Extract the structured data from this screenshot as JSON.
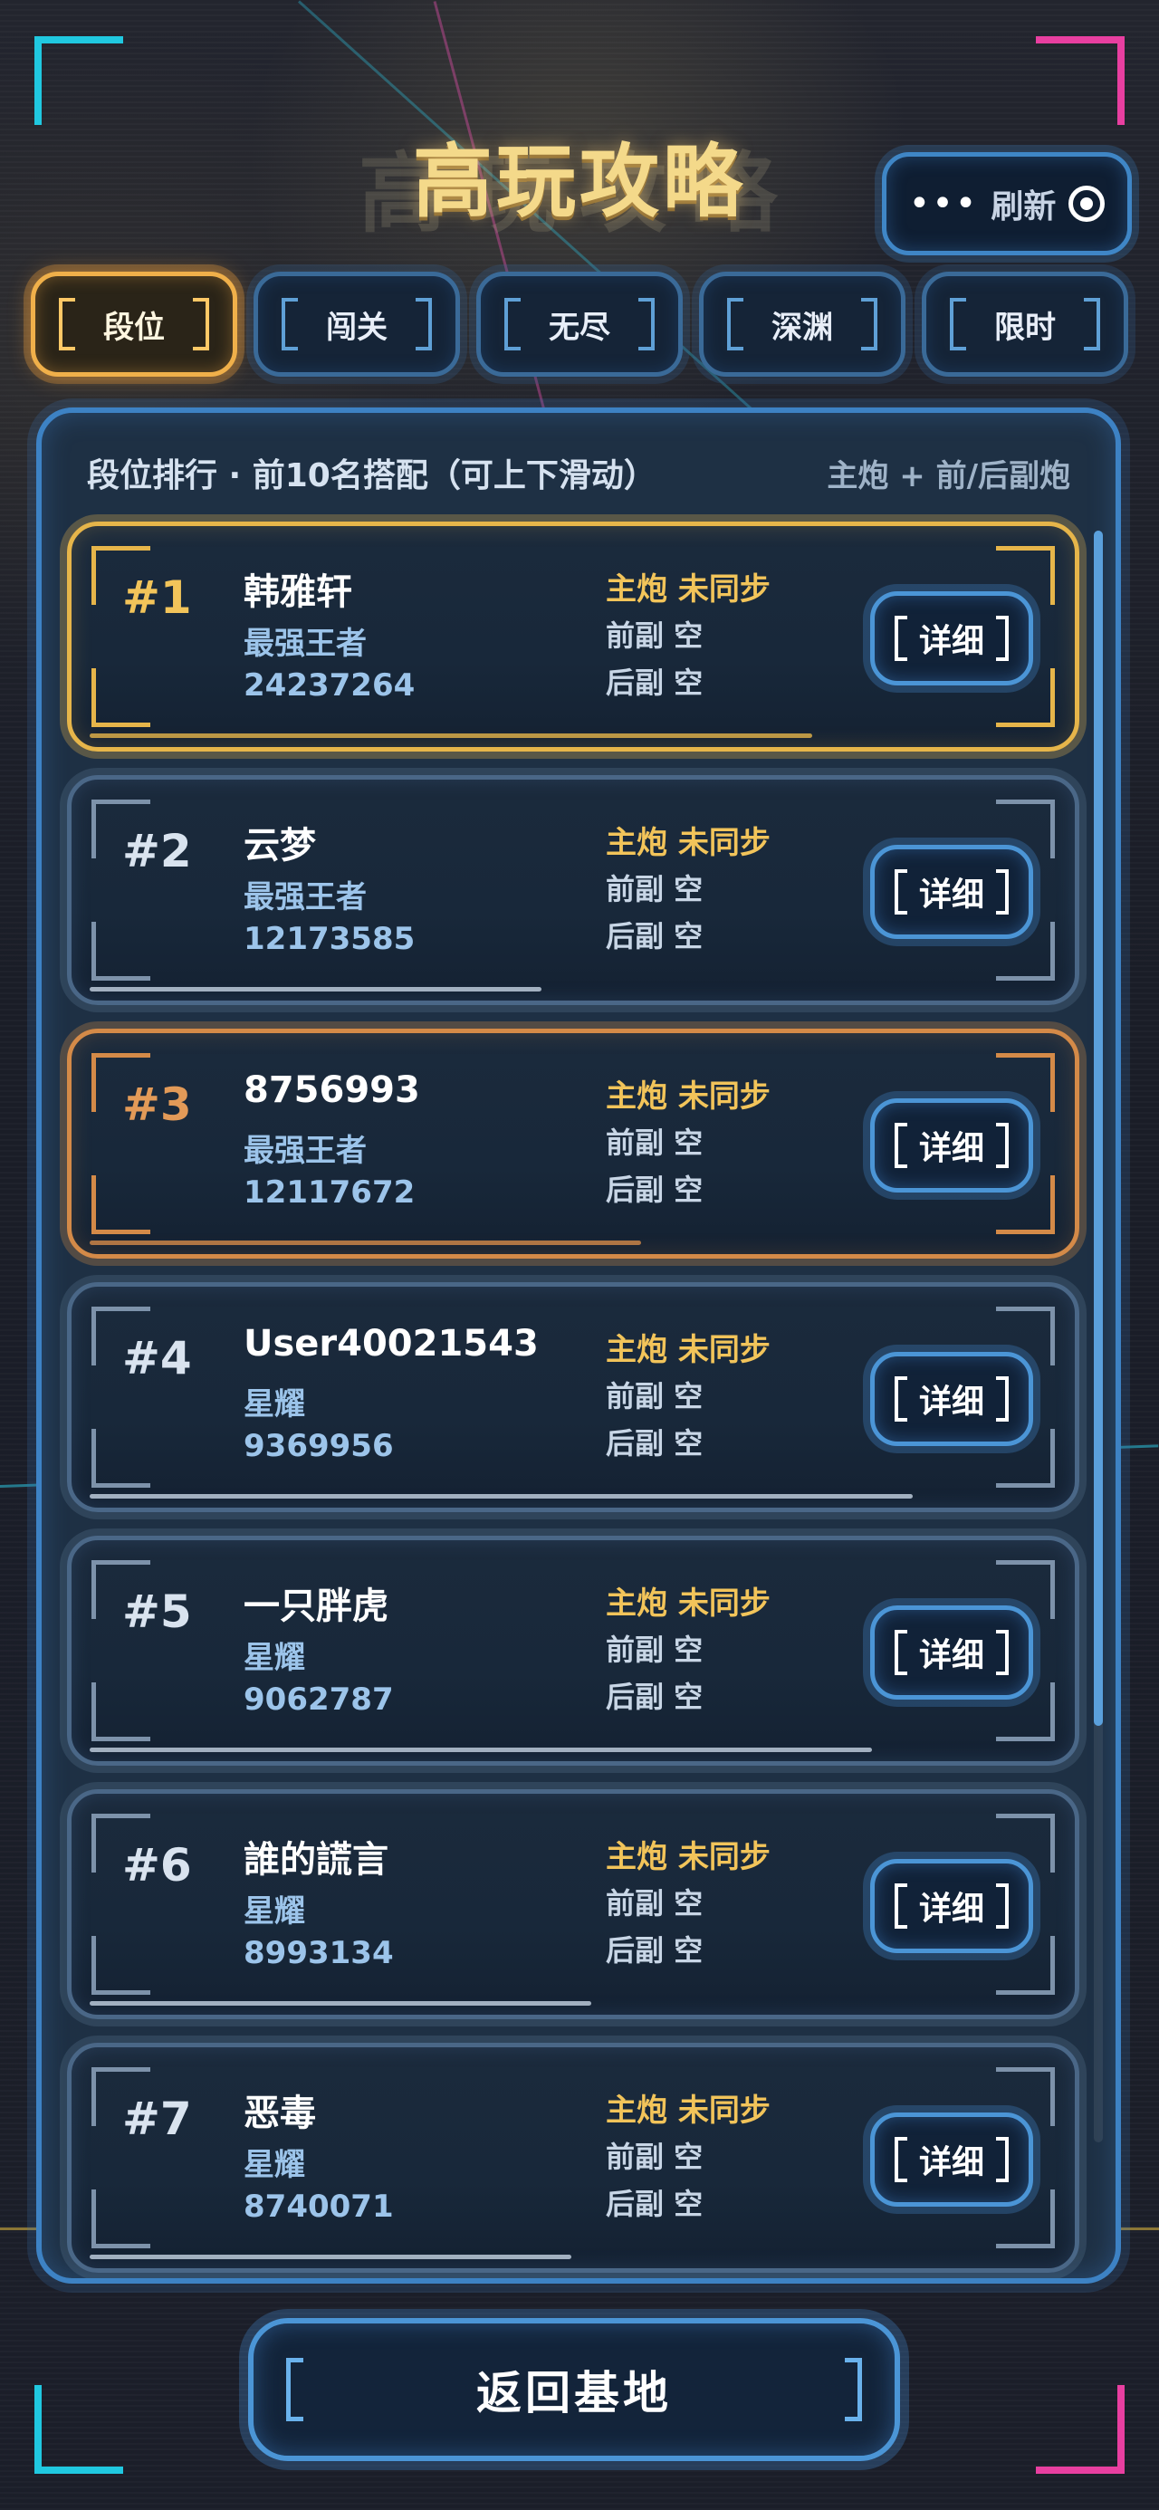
{
  "header": {
    "title": "高玩攻略",
    "refresh_dots": "•••",
    "refresh_label": "刷新"
  },
  "tabs": [
    {
      "label": "段位",
      "active": true
    },
    {
      "label": "闯关",
      "active": false
    },
    {
      "label": "无尽",
      "active": false
    },
    {
      "label": "深渊",
      "active": false
    },
    {
      "label": "限时",
      "active": false
    }
  ],
  "panel": {
    "heading": "段位排行 · 前10名搭配（可上下滑动）",
    "legend": "主炮 + 前/后副炮"
  },
  "entries": [
    {
      "rank": "#1",
      "name": "韩雅轩",
      "tier": "最强王者",
      "score": "24237264",
      "main": "主炮  未同步",
      "front": "前副  空",
      "rear": "后副  空",
      "detail": "详细",
      "progress": 0.72
    },
    {
      "rank": "#2",
      "name": "云梦",
      "tier": "最强王者",
      "score": "12173585",
      "main": "主炮  未同步",
      "front": "前副  空",
      "rear": "后副  空",
      "detail": "详细",
      "progress": 0.45
    },
    {
      "rank": "#3",
      "name": "8756993",
      "tier": "最强王者",
      "score": "12117672",
      "main": "主炮  未同步",
      "front": "前副  空",
      "rear": "后副  空",
      "detail": "详细",
      "progress": 0.55
    },
    {
      "rank": "#4",
      "name": "User40021543",
      "tier": "星耀",
      "score": "9369956",
      "main": "主炮  未同步",
      "front": "前副  空",
      "rear": "后副  空",
      "detail": "详细",
      "progress": 0.82
    },
    {
      "rank": "#5",
      "name": "一只胖虎",
      "tier": "星耀",
      "score": "9062787",
      "main": "主炮  未同步",
      "front": "前副  空",
      "rear": "后副  空",
      "detail": "详细",
      "progress": 0.78
    },
    {
      "rank": "#6",
      "name": "誰的謊言",
      "tier": "星耀",
      "score": "8993134",
      "main": "主炮  未同步",
      "front": "前副  空",
      "rear": "后副  空",
      "detail": "详细",
      "progress": 0.5
    },
    {
      "rank": "#7",
      "name": "恶毒",
      "tier": "星耀",
      "score": "8740071",
      "main": "主炮  未同步",
      "front": "前副  空",
      "rear": "后副  空",
      "detail": "详细",
      "progress": 0.48
    }
  ],
  "footer": {
    "back_label": "返回基地"
  },
  "colors": {
    "gold": "#e6b54a",
    "bronze": "#d48a48",
    "accent_blue": "#4b95d6",
    "title": "#f4d98a"
  }
}
